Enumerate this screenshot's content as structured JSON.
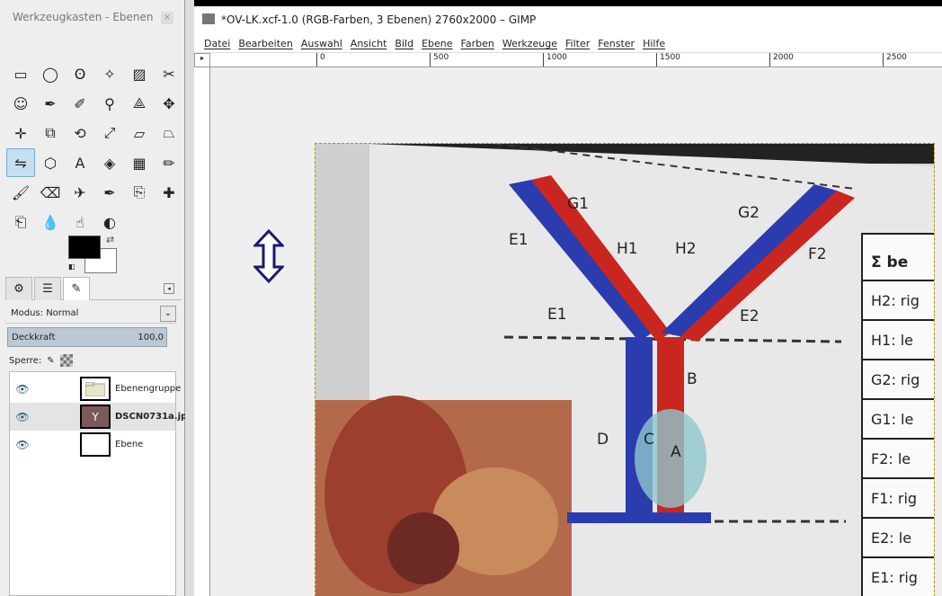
{
  "toolbox": {
    "title": "Werkzeugkasten - Ebenen",
    "close_label": "×",
    "tools": [
      "rect-select",
      "ellipse-select",
      "free-select",
      "fuzzy-select",
      "color-select",
      "scissors-select",
      "foreground-select",
      "paths",
      "color-picker",
      "zoom",
      "measure",
      "move",
      "align",
      "crop",
      "rotate",
      "scale",
      "shear",
      "perspective",
      "flip",
      "cage-transform",
      "text",
      "bucket-fill",
      "blend",
      "pencil",
      "paintbrush",
      "eraser",
      "airbrush",
      "ink",
      "clone",
      "heal",
      "perspective-clone",
      "blur",
      "smudge",
      "dodge-burn"
    ],
    "active_tool_index": 18
  },
  "colors": {
    "foreground": "#000000",
    "background": "#ffffff"
  },
  "layers_panel": {
    "mode_label": "Modus: Normal",
    "opacity_label": "Deckkraft",
    "opacity_value": "100,0",
    "lock_label": "Sperre:",
    "layers": [
      {
        "name": "Ebenengruppe",
        "visible": true,
        "selected": false,
        "bold": false,
        "thumb": "folder"
      },
      {
        "name": "DSCN0731a.jp",
        "visible": true,
        "selected": true,
        "bold": true,
        "thumb": "photo"
      },
      {
        "name": "Ebene",
        "visible": true,
        "selected": false,
        "bold": false,
        "thumb": "white"
      }
    ]
  },
  "window": {
    "title": "*OV-LK.xcf-1.0 (RGB-Farben, 3 Ebenen) 2760x2000 – GIMP"
  },
  "menubar": [
    "Datei",
    "Bearbeiten",
    "Auswahl",
    "Ansicht",
    "Bild",
    "Ebene",
    "Farben",
    "Werkzeuge",
    "Filter",
    "Fenster",
    "Hilfe"
  ],
  "ruler": {
    "ticks": [
      "0",
      "500",
      "1000",
      "1500",
      "2000",
      "2500"
    ],
    "left_label": "0"
  },
  "canvas_text": {
    "labels_left": [
      "E1",
      "G1",
      "H1",
      "H2",
      "G2",
      "F2",
      "E1",
      "E2",
      "D",
      "C",
      "B",
      "A"
    ],
    "table_header": "Σ be",
    "table_rows": [
      "H2: rig",
      "H1: le",
      "G2: rig",
      "G1: le",
      "F2: le",
      "F1: rig",
      "E2: le",
      "E1: rig"
    ]
  }
}
